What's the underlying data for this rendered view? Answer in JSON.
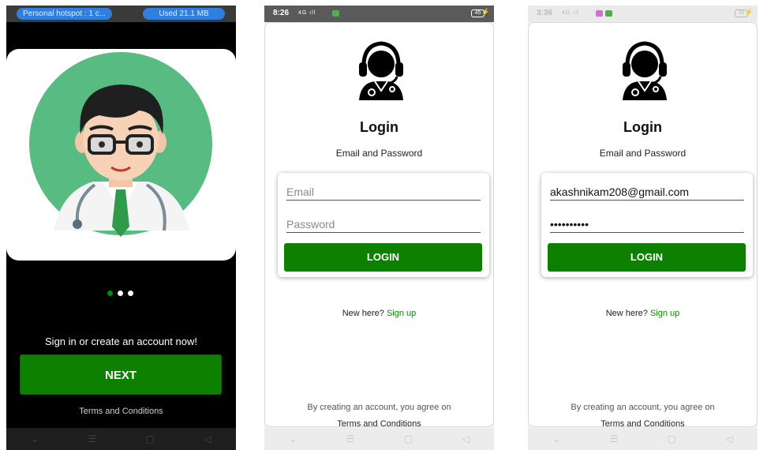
{
  "screen1": {
    "status_left": "Personal hotspot : 1 c...",
    "status_right": "Used  21.1 MB",
    "carousel": {
      "count": 3,
      "active_index": 0
    },
    "signin_text": "Sign in or create an account now!",
    "next_label": "NEXT",
    "terms_label": "Terms and Conditions"
  },
  "screen2": {
    "status": {
      "time": "8:26",
      "signal": "4G ıll",
      "battery": "45"
    },
    "title": "Login",
    "subtitle": "Email and Password",
    "email_placeholder": "Email",
    "email_value": "",
    "password_placeholder": "Password",
    "password_value": "",
    "login_label": "LOGIN",
    "new_here": "New here?",
    "signup_label": "Sign up",
    "agree_text": "By creating an account, you agree on",
    "terms_label": "Terms and Conditions"
  },
  "screen3": {
    "status": {
      "time": "3:36",
      "signal": "4G ıll",
      "battery": "36"
    },
    "title": "Login",
    "subtitle": "Email and Password",
    "email_placeholder": "Email",
    "email_value": "akashnikam208@gmail.com",
    "password_placeholder": "Password",
    "password_value": "••••••••••",
    "login_label": "LOGIN",
    "new_here": "New here?",
    "signup_label": "Sign up",
    "agree_text": "By creating an account, you agree on",
    "terms_label": "Terms and Conditions"
  },
  "nav_icons": [
    "chevron-down-icon",
    "menu-icon",
    "home-square-icon",
    "back-triangle-icon"
  ],
  "colors": {
    "accent_green": "#0d8000",
    "hotspot_blue": "#2f7fe0",
    "doctor_bg": "#57bb82"
  }
}
